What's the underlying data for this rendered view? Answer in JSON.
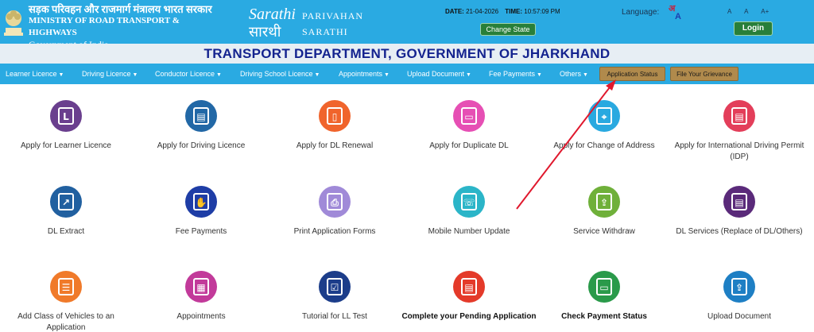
{
  "header": {
    "ministry_hindi": "सड़क परिवहन और राजमार्ग मंत्रालय भारत सरकार",
    "ministry_en": "MINISTRY OF ROAD TRANSPORT & HIGHWAYS",
    "gov": "Government of India",
    "brand_line1": "PARIVAHAN",
    "brand_line2": "SARATHI",
    "date_label": "DATE:",
    "date_value": "21-04-2026",
    "time_label": "TIME:",
    "time_value": "10:57:09 PM",
    "change_state": "Change State",
    "language_label": "Language:",
    "font_small": "A",
    "font_normal": "A",
    "font_large": "A+",
    "login": "Login"
  },
  "title": "TRANSPORT DEPARTMENT, GOVERNMENT OF JHARKHAND",
  "nav": {
    "items": [
      "Learner Licence",
      "Driving Licence",
      "Conductor Licence",
      "Driving School Licence",
      "Appointments",
      "Upload Document",
      "Fee Payments",
      "Others"
    ],
    "application_status": "Application Status",
    "grievance": "File Your Grievance"
  },
  "tiles": [
    {
      "label": "Apply for Learner Licence",
      "icon": "learner-licence-icon",
      "color": "#6a3f8e"
    },
    {
      "label": "Apply for Driving Licence",
      "icon": "driving-licence-icon",
      "color": "#2268a6"
    },
    {
      "label": "Apply for DL Renewal",
      "icon": "dl-renewal-icon",
      "color": "#f0642c"
    },
    {
      "label": "Apply for Duplicate DL",
      "icon": "duplicate-dl-icon",
      "color": "#e64fb4"
    },
    {
      "label": "Apply for Change of Address",
      "icon": "change-address-icon",
      "color": "#29a9e0"
    },
    {
      "label": "Apply for International Driving Permit (IDP)",
      "icon": "idp-icon",
      "color": "#e33e5a"
    },
    {
      "label": "DL Extract",
      "icon": "dl-extract-icon",
      "color": "#2160a0"
    },
    {
      "label": "Fee Payments",
      "icon": "fee-payments-icon",
      "color": "#1e3da6"
    },
    {
      "label": "Print Application Forms",
      "icon": "print-icon",
      "color": "#a08ad8"
    },
    {
      "label": "Mobile Number Update",
      "icon": "mobile-update-icon",
      "color": "#2bb5c8"
    },
    {
      "label": "Service Withdraw",
      "icon": "service-withdraw-icon",
      "color": "#6fb03a"
    },
    {
      "label": "DL Services (Replace of DL/Others)",
      "icon": "dl-services-icon",
      "color": "#5a2a7a"
    },
    {
      "label": "Add Class of Vehicles to an Application",
      "icon": "add-class-icon",
      "color": "#f07a2a"
    },
    {
      "label": "Appointments",
      "icon": "appointments-icon",
      "color": "#c23a9a"
    },
    {
      "label": "Tutorial for LL Test",
      "icon": "tutorial-icon",
      "color": "#1c3d8a"
    },
    {
      "label": "Complete your Pending Application",
      "icon": "pending-application-icon",
      "color": "#e43a2a"
    },
    {
      "label": "Check Payment Status",
      "icon": "payment-status-icon",
      "color": "#2a9a4a"
    },
    {
      "label": "Upload Document",
      "icon": "upload-document-icon",
      "color": "#1e7fc4"
    }
  ]
}
